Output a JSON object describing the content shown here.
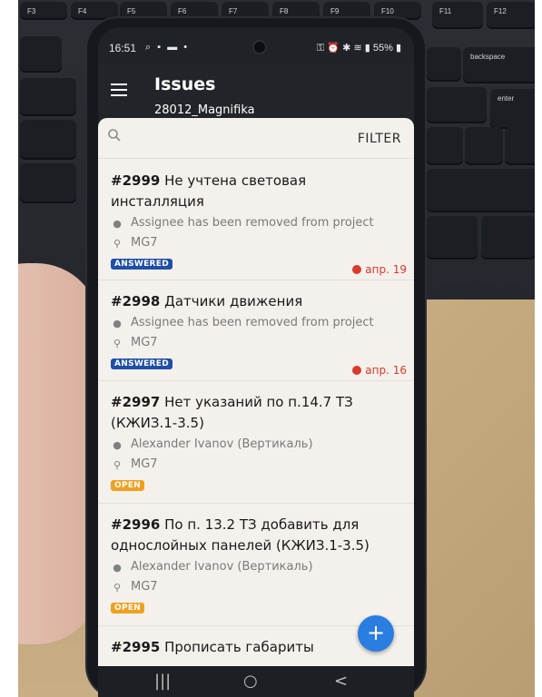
{
  "keyboard": {
    "keys": [
      {
        "label": "F3"
      },
      {
        "label": "F4"
      },
      {
        "label": "F5"
      },
      {
        "label": "F6"
      },
      {
        "label": "F7"
      },
      {
        "label": "F8"
      },
      {
        "label": "F9"
      },
      {
        "label": "F10"
      },
      {
        "label": "F11"
      },
      {
        "label": "F12"
      },
      {
        "label": "backspace"
      },
      {
        "label": "enter"
      }
    ]
  },
  "status": {
    "time": "16:51",
    "battery": "55%"
  },
  "appbar": {
    "title": "Issues",
    "subtitle": "28012_Magnifika"
  },
  "search": {
    "filter_label": "FILTER"
  },
  "issues": [
    {
      "number": "#2999",
      "title": "Не учтена световая инсталляция",
      "assignee": "Assignee has been removed from project",
      "location": "MG7",
      "status": "ANSWERED",
      "due": "апр. 19"
    },
    {
      "number": "#2998",
      "title": "Датчики движения",
      "assignee": "Assignee has been removed from project",
      "location": "MG7",
      "status": "ANSWERED",
      "due": "апр. 16"
    },
    {
      "number": "#2997",
      "title": "Нет указаний по п.14.7 ТЗ (КЖИЗ.1-3.5)",
      "assignee": "Alexander Ivanov (Вертикаль)",
      "location": "MG7",
      "status": "OPEN",
      "due": ""
    },
    {
      "number": "#2996",
      "title": "По п. 13.2 ТЗ добавить для однослойных панелей (КЖИЗ.1-3.5)",
      "assignee": "Alexander Ivanov (Вертикаль)",
      "location": "MG7",
      "status": "OPEN",
      "due": ""
    },
    {
      "number": "#2995",
      "title": "Прописать габариты",
      "assignee": "",
      "location": "",
      "status": "",
      "due": ""
    }
  ],
  "fab": {
    "label": "+"
  },
  "navbar": {
    "recent": "|||",
    "home": "○",
    "back": "<"
  },
  "colors": {
    "appbar": "#212529",
    "answered_badge": "#1f4fa8",
    "open_badge": "#f0a020",
    "due_red": "#d83a2d",
    "fab_blue": "#2a7de1"
  }
}
